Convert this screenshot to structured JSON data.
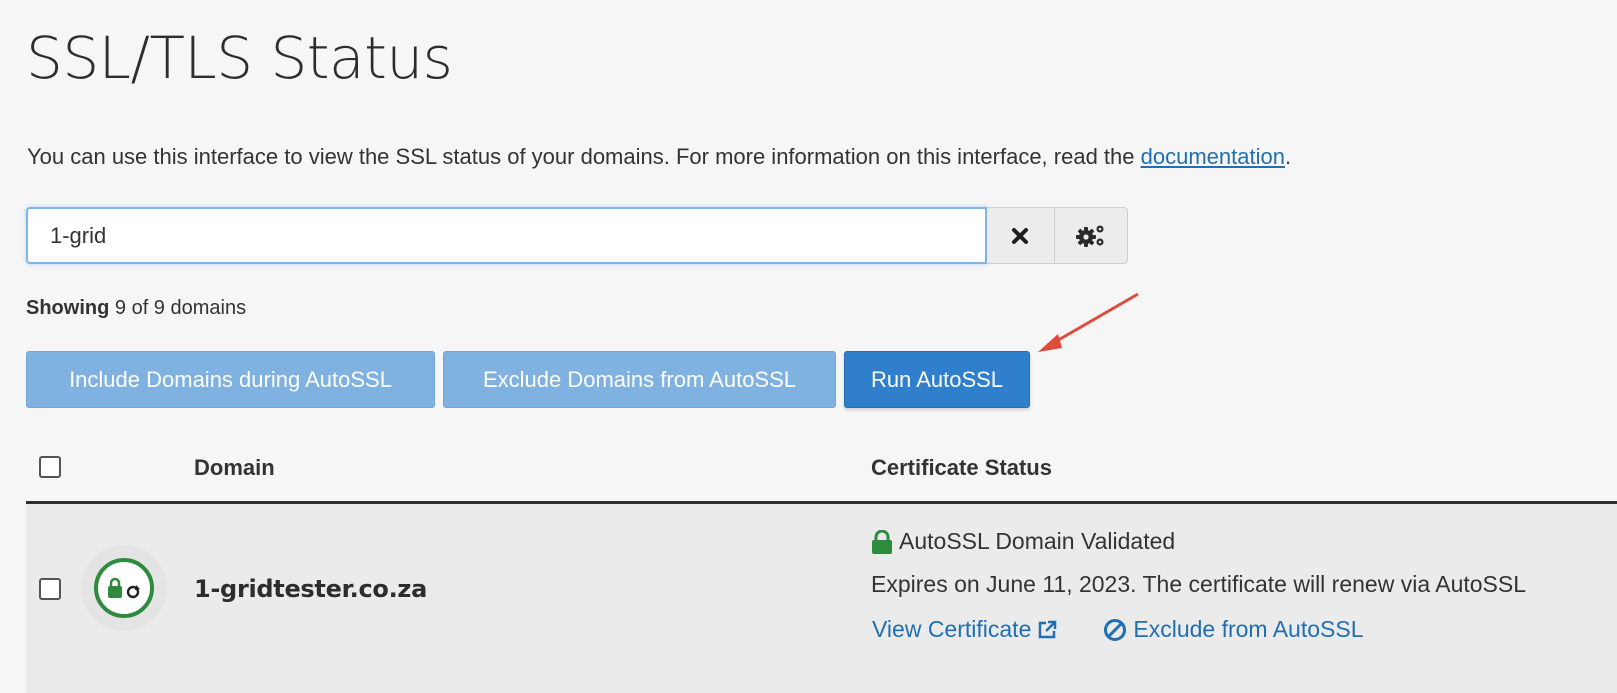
{
  "page": {
    "title": "SSL/TLS Status",
    "description_prefix": "You can use this interface to view the SSL status of your domains. For more information on this interface, read the ",
    "documentation_link": "documentation",
    "description_suffix": "."
  },
  "search": {
    "value": "1-grid",
    "clear_icon": "close-icon",
    "settings_icon": "gears-icon"
  },
  "summary": {
    "showing_label": "Showing",
    "showing_count": " 9 of 9 domains"
  },
  "actions": {
    "include_label": "Include Domains during AutoSSL",
    "exclude_label": "Exclude Domains from AutoSSL",
    "run_label": "Run AutoSSL"
  },
  "table": {
    "headers": {
      "domain": "Domain",
      "certificate_status": "Certificate Status"
    },
    "rows": [
      {
        "domain": "1-gridtester.co.za",
        "certificate_type": "AutoSSL Domain Validated",
        "expires_text": "Expires on June 11, 2023. The certificate will renew via AutoSSL",
        "view_certificate_label": "View Certificate",
        "exclude_label": "Exclude from AutoSSL"
      }
    ]
  },
  "colors": {
    "primary": "#2f7fcc",
    "primary_light": "#7fb2e0",
    "link": "#1f6fb2",
    "success": "#2e8b3e",
    "annotation_arrow": "#e04a3a"
  }
}
